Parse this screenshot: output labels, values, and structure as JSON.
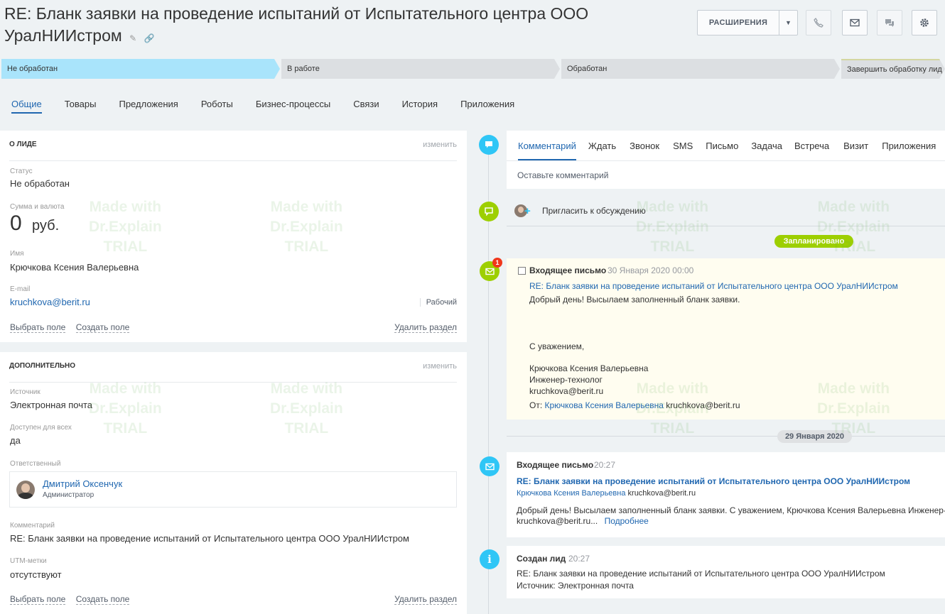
{
  "header": {
    "title": "RE: Бланк заявки на проведение испытаний от Испытательного центра ООО УралНИИстром",
    "extensions_label": "РАСШИРЕНИЯ"
  },
  "stages": [
    "Не обработан",
    "В работе",
    "Обработан",
    "Завершить обработку лид"
  ],
  "tabs": [
    "Общие",
    "Товары",
    "Предложения",
    "Роботы",
    "Бизнес-процессы",
    "Связи",
    "История",
    "Приложения"
  ],
  "about": {
    "heading": "О ЛИДЕ",
    "edit": "изменить",
    "status_label": "Статус",
    "status_value": "Не обработан",
    "amount_label": "Сумма и валюта",
    "amount_value": "0",
    "currency": "руб.",
    "name_label": "Имя",
    "name_value": "Крючкова Ксения Валерьевна",
    "email_label": "E-mail",
    "email_value": "kruchkova@berit.ru",
    "email_type": "Рабочий",
    "select_field": "Выбрать поле",
    "create_field": "Создать поле",
    "delete_section": "Удалить раздел"
  },
  "extra": {
    "heading": "ДОПОЛНИТЕЛЬНО",
    "edit": "изменить",
    "source_label": "Источник",
    "source_value": "Электронная почта",
    "public_label": "Доступен для всех",
    "public_value": "да",
    "responsible_label": "Ответственный",
    "responsible_name": "Дмитрий Оксенчук",
    "responsible_role": "Администратор",
    "comment_label": "Комментарий",
    "comment_value": "RE: Бланк заявки на проведение испытаний от Испытательного центра ООО УралНИИстром",
    "utm_label": "UTM-метки",
    "utm_value": "отсутствуют",
    "select_field": "Выбрать поле",
    "create_field": "Создать поле",
    "delete_section": "Удалить раздел"
  },
  "composer": {
    "tabs": [
      "Комментарий",
      "Ждать",
      "Звонок",
      "SMS",
      "Письмо",
      "Задача",
      "Встреча",
      "Визит",
      "Приложения"
    ],
    "placeholder": "Оставьте комментарий"
  },
  "invite": "Пригласить к обсуждению",
  "planned_badge": "Запланировано",
  "planned_email": {
    "counter": "1",
    "title": "Входящее письмо",
    "date": "30 Января 2020 00:00",
    "subject": "RE: Бланк заявки на проведение испытаний от Испытательного центра ООО УралНИИстром",
    "line1": "Добрый день! Высылаем заполненный бланк заявки.",
    "line2": "С уважением,",
    "line3": "Крючкова Ксения Валерьевна",
    "line4": "Инженер-технолог",
    "line5": "kruchkova@berit.ru",
    "from_label": "От:",
    "from_name": "Крючкова Ксения Валерьевна",
    "from_email": "kruchkova@berit.ru"
  },
  "date_badge": "29 Января 2020",
  "email_item": {
    "title": "Входящее письмо",
    "time": "20:27",
    "subject": "RE: Бланк заявки на проведение испытаний от Испытательного центра ООО УралНИИстром",
    "sender": "Крючкова Ксения Валерьевна",
    "sender_email": "kruchkova@berit.ru",
    "body1": "Добрый день! Высылаем заполненный бланк заявки.   С уважением, Крючкова Ксения Валерьевна Инженер-технолог",
    "body2": "kruchkova@berit.ru...",
    "more": "Подробнее"
  },
  "created_item": {
    "title": "Создан лид",
    "time": "20:27",
    "subject": "RE: Бланк заявки на проведение испытаний от Испытательного центра ООО УралНИИстром",
    "source": "Источник: Электронная почта"
  },
  "watermark": {
    "line1": "Made with",
    "line2": "Dr.Explain",
    "line3": "TRIAL"
  },
  "colors": {
    "accent": "#2067b0",
    "stage_active": "#a9e4fb",
    "stage_inactive": "#dcdfe2",
    "timeline_green": "#9dcf00",
    "timeline_blue": "#2fc6f6",
    "planned_bg": "#fffdf0"
  }
}
